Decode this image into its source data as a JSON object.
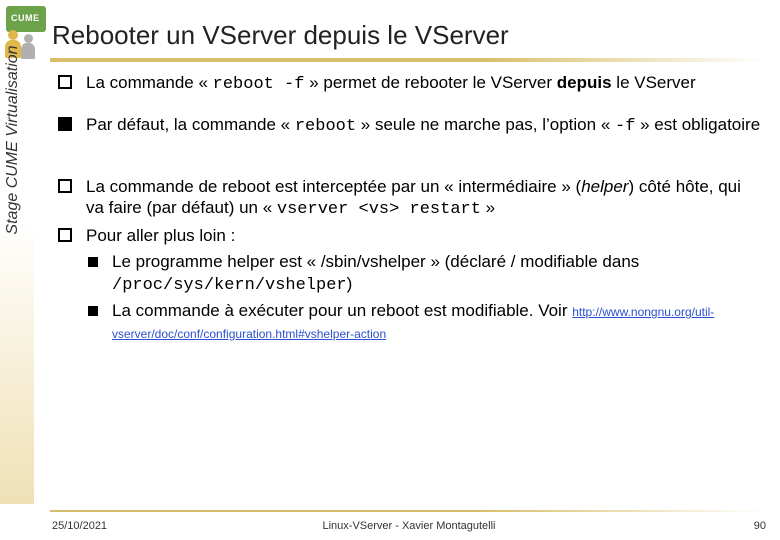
{
  "brand": "CUME",
  "side_label": "Stage CUME Virtualisation",
  "title": "Rebooter un VServer depuis le VServer",
  "bullets": {
    "b1": {
      "pre": "La commande « ",
      "code": "reboot -f",
      "post": " » permet de rebooter le VServer "
    },
    "b1_bold": "depuis",
    "b1_tail": " le VServer",
    "b2": {
      "pre": "Par défaut, la commande « ",
      "code1": "reboot",
      "mid": " » seule ne marche pas, l’option « ",
      "code2": "-f",
      "post": " » est obligatoire"
    },
    "b3": {
      "pre": "La commande de reboot est interceptée par un « intermédiaire » (",
      "italic": "helper",
      "mid": ") côté hôte, qui va faire (par défaut) un « ",
      "code": "vserver <vs> restart",
      "post": " »"
    },
    "b4": "Pour aller plus loin :",
    "s1": {
      "pre": "Le programme helper est « /sbin/vshelper » (déclaré / modifiable dans ",
      "code": "/proc/sys/kern/vshelper",
      "post": ")"
    },
    "s2": {
      "pre": "La commande à exécuter pour un reboot est modifiable. Voir ",
      "link": "http://www.nongnu.org/util-vserver/doc/conf/configuration.html#vshelper-action"
    }
  },
  "footer": {
    "date": "25/10/2021",
    "center": "Linux-VServer - Xavier Montagutelli",
    "page": "90"
  }
}
